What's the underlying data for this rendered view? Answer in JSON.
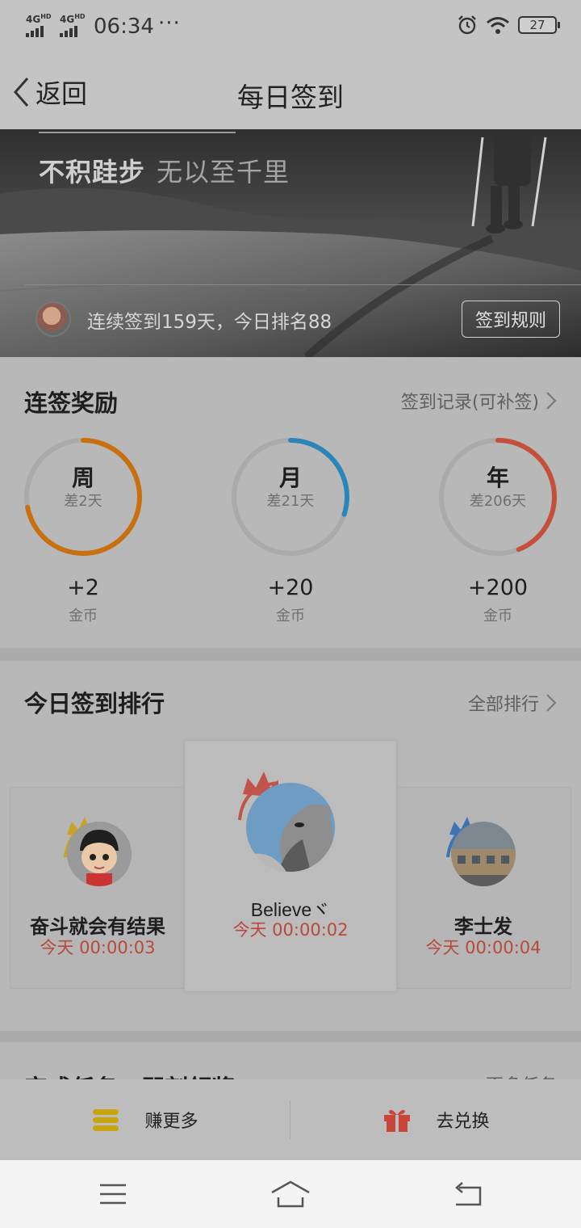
{
  "status_bar": {
    "signal_1": "4G",
    "signal_1_sup": "HD",
    "signal_2": "4G",
    "signal_2_sup": "HD",
    "time": "06:34",
    "more": "···",
    "battery": "27",
    "icons": [
      "alarm-icon",
      "wifi-icon",
      "battery-icon"
    ]
  },
  "header": {
    "back_label": "返回",
    "title": "每日签到"
  },
  "banner": {
    "motto_bold": "不积跬步",
    "motto_light": "无以至千里",
    "streak_text": "连续签到159天，今日排名88",
    "rules_button": "签到规则"
  },
  "rewards": {
    "title": "连签奖励",
    "record_link": "签到记录(可补签)",
    "items": [
      {
        "label": "周",
        "remaining": "差2天",
        "amount": "+2",
        "unit": "金币",
        "progress": 0.72,
        "color": "#c8700f"
      },
      {
        "label": "月",
        "remaining": "差21天",
        "amount": "+20",
        "unit": "金币",
        "progress": 0.3,
        "color": "#2a86b8"
      },
      {
        "label": "年",
        "remaining": "差206天",
        "amount": "+200",
        "unit": "金币",
        "progress": 0.44,
        "color": "#c44f3a"
      }
    ]
  },
  "ranking": {
    "title": "今日签到排行",
    "all_link": "全部排行",
    "entries": [
      {
        "name": "奋斗就会有结果",
        "time": "今天 00:00:03",
        "crown_color": "#c9a227"
      },
      {
        "name": "Believeヾ",
        "time": "今天 00:00:02",
        "crown_color": "#c0544a"
      },
      {
        "name": "李士发",
        "time": "今天 00:00:04",
        "crown_color": "#3f73b5"
      }
    ]
  },
  "task_section": {
    "title": "完成任务，即刻领奖",
    "more_link": "更多任务"
  },
  "actions": {
    "earn_more": "赚更多",
    "exchange": "去兑换"
  },
  "colors": {
    "accent_orange": "#c8700f",
    "accent_blue": "#2a86b8",
    "accent_red": "#c44f3a",
    "time_red": "#b84a3a"
  }
}
